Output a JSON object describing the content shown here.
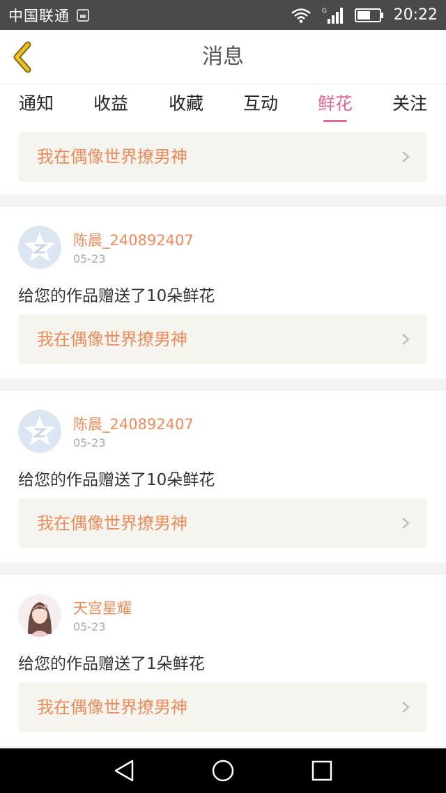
{
  "status": {
    "carrier": "中国联通",
    "network_type": "G",
    "time": "20:22"
  },
  "header": {
    "title": "消息",
    "back_icon": "chevron-left-icon"
  },
  "tabs": [
    {
      "label": "通知",
      "active": false
    },
    {
      "label": "收益",
      "active": false
    },
    {
      "label": "收藏",
      "active": false
    },
    {
      "label": "互动",
      "active": false
    },
    {
      "label": "鲜花",
      "active": true
    },
    {
      "label": "关注",
      "active": false
    }
  ],
  "top_work": {
    "title": "我在偶像世界撩男神"
  },
  "messages": [
    {
      "username": "陈晨_240892407",
      "date": "05-23",
      "text": "给您的作品赠送了10朵鲜花",
      "work_title": "我在偶像世界撩男神",
      "avatar": "qzone-default-avatar-icon"
    },
    {
      "username": "陈晨_240892407",
      "date": "05-23",
      "text": "给您的作品赠送了10朵鲜花",
      "work_title": "我在偶像世界撩男神",
      "avatar": "qzone-default-avatar-icon"
    },
    {
      "username": "天宫星耀",
      "date": "05-23",
      "text": "给您的作品赠送了1朵鲜花",
      "work_title": "我在偶像世界撩男神",
      "avatar": "user-photo-avatar"
    }
  ],
  "colors": {
    "accent": "#e0679a",
    "work_title": "#ee8a5a",
    "username": "#ee8a5a",
    "back_icon": "#f0c21e"
  }
}
